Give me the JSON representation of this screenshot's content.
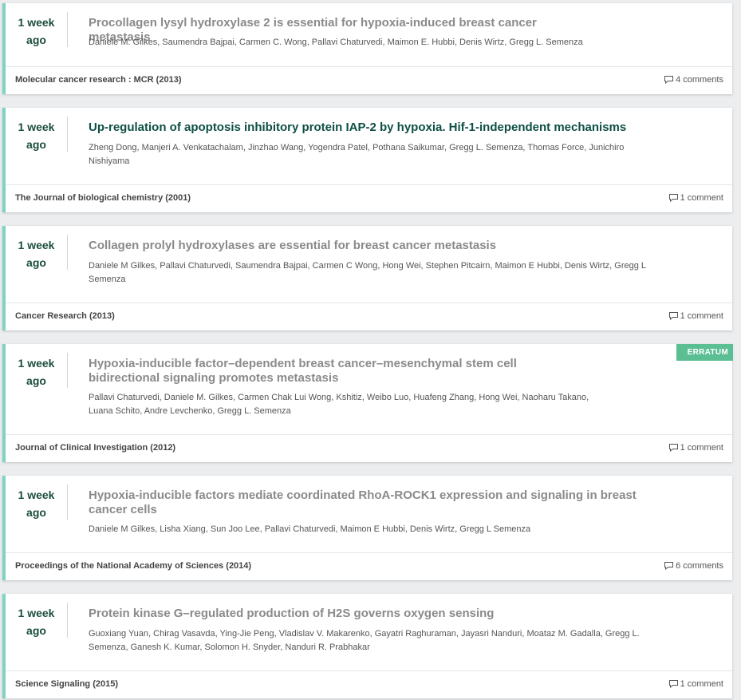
{
  "colors": {
    "accent": "#7fd3c5",
    "age_text": "#1b4d3e",
    "active_title": "#0f4f46",
    "badge": "#5cbf94"
  },
  "articles": [
    {
      "age_line1": "1 week",
      "age_line2": "ago",
      "title": "Procollagen lysyl hydroxylase 2 is essential for hypoxia-induced breast cancer metastasis",
      "authors": "Daniele M. Gilkes, Saumendra Bajpai, Carmen C. Wong, Pallavi Chaturvedi, Maimon E. Hubbi, Denis Wirtz, Gregg L. Semenza",
      "journal": "Molecular cancer research : MCR (2013)",
      "comments": "4 comments"
    },
    {
      "age_line1": "1 week",
      "age_line2": "ago",
      "title": "Up-regulation of apoptosis inhibitory protein IAP-2 by hypoxia. Hif-1-independent mechanisms",
      "authors": "Zheng Dong, Manjeri A. Venkatachalam, Jinzhao Wang, Yogendra Patel, Pothana Saikumar, Gregg L. Semenza, Thomas Force, Junichiro Nishiyama",
      "journal": "The Journal of biological chemistry (2001)",
      "comments": "1 comment"
    },
    {
      "age_line1": "1 week",
      "age_line2": "ago",
      "title": "Collagen prolyl hydroxylases are essential for breast cancer metastasis",
      "authors": "Daniele M Gilkes, Pallavi Chaturvedi, Saumendra Bajpai, Carmen C Wong, Hong Wei, Stephen Pitcairn, Maimon E Hubbi, Denis Wirtz, Gregg L Semenza",
      "journal": "Cancer Research (2013)",
      "comments": "1 comment"
    },
    {
      "age_line1": "1 week",
      "age_line2": "ago",
      "title": "Hypoxia-inducible factor–dependent breast cancer–mesenchymal stem cell bidirectional signaling promotes metastasis",
      "authors": "Pallavi Chaturvedi, Daniele M. Gilkes, Carmen Chak Lui Wong, Kshitiz, Weibo Luo, Huafeng Zhang, Hong Wei, Naoharu Takano, Luana Schito, Andre Levchenko, Gregg L. Semenza",
      "journal": "Journal of Clinical Investigation (2012)",
      "comments": "1 comment",
      "badge": "ERRATUM"
    },
    {
      "age_line1": "1 week",
      "age_line2": "ago",
      "title": "Hypoxia-inducible factors mediate coordinated RhoA-ROCK1 expression and signaling in breast cancer cells",
      "authors": "Daniele M Gilkes, Lisha Xiang, Sun Joo Lee, Pallavi Chaturvedi, Maimon E Hubbi, Denis Wirtz, Gregg L Semenza",
      "journal": "Proceedings of the National Academy of Sciences (2014)",
      "comments": "6 comments"
    },
    {
      "age_line1": "1 week",
      "age_line2": "ago",
      "title": "Protein kinase G–regulated production of H2S governs oxygen sensing",
      "authors": "Guoxiang Yuan, Chirag Vasavda, Ying-Jie Peng, Vladislav V. Makarenko, Gayatri Raghuraman, Jayasri Nanduri, Moataz M. Gadalla, Gregg L. Semenza, Ganesh K. Kumar, Solomon H. Snyder, Nanduri R. Prabhakar",
      "journal": "Science Signaling (2015)",
      "comments": "1 comment"
    }
  ]
}
